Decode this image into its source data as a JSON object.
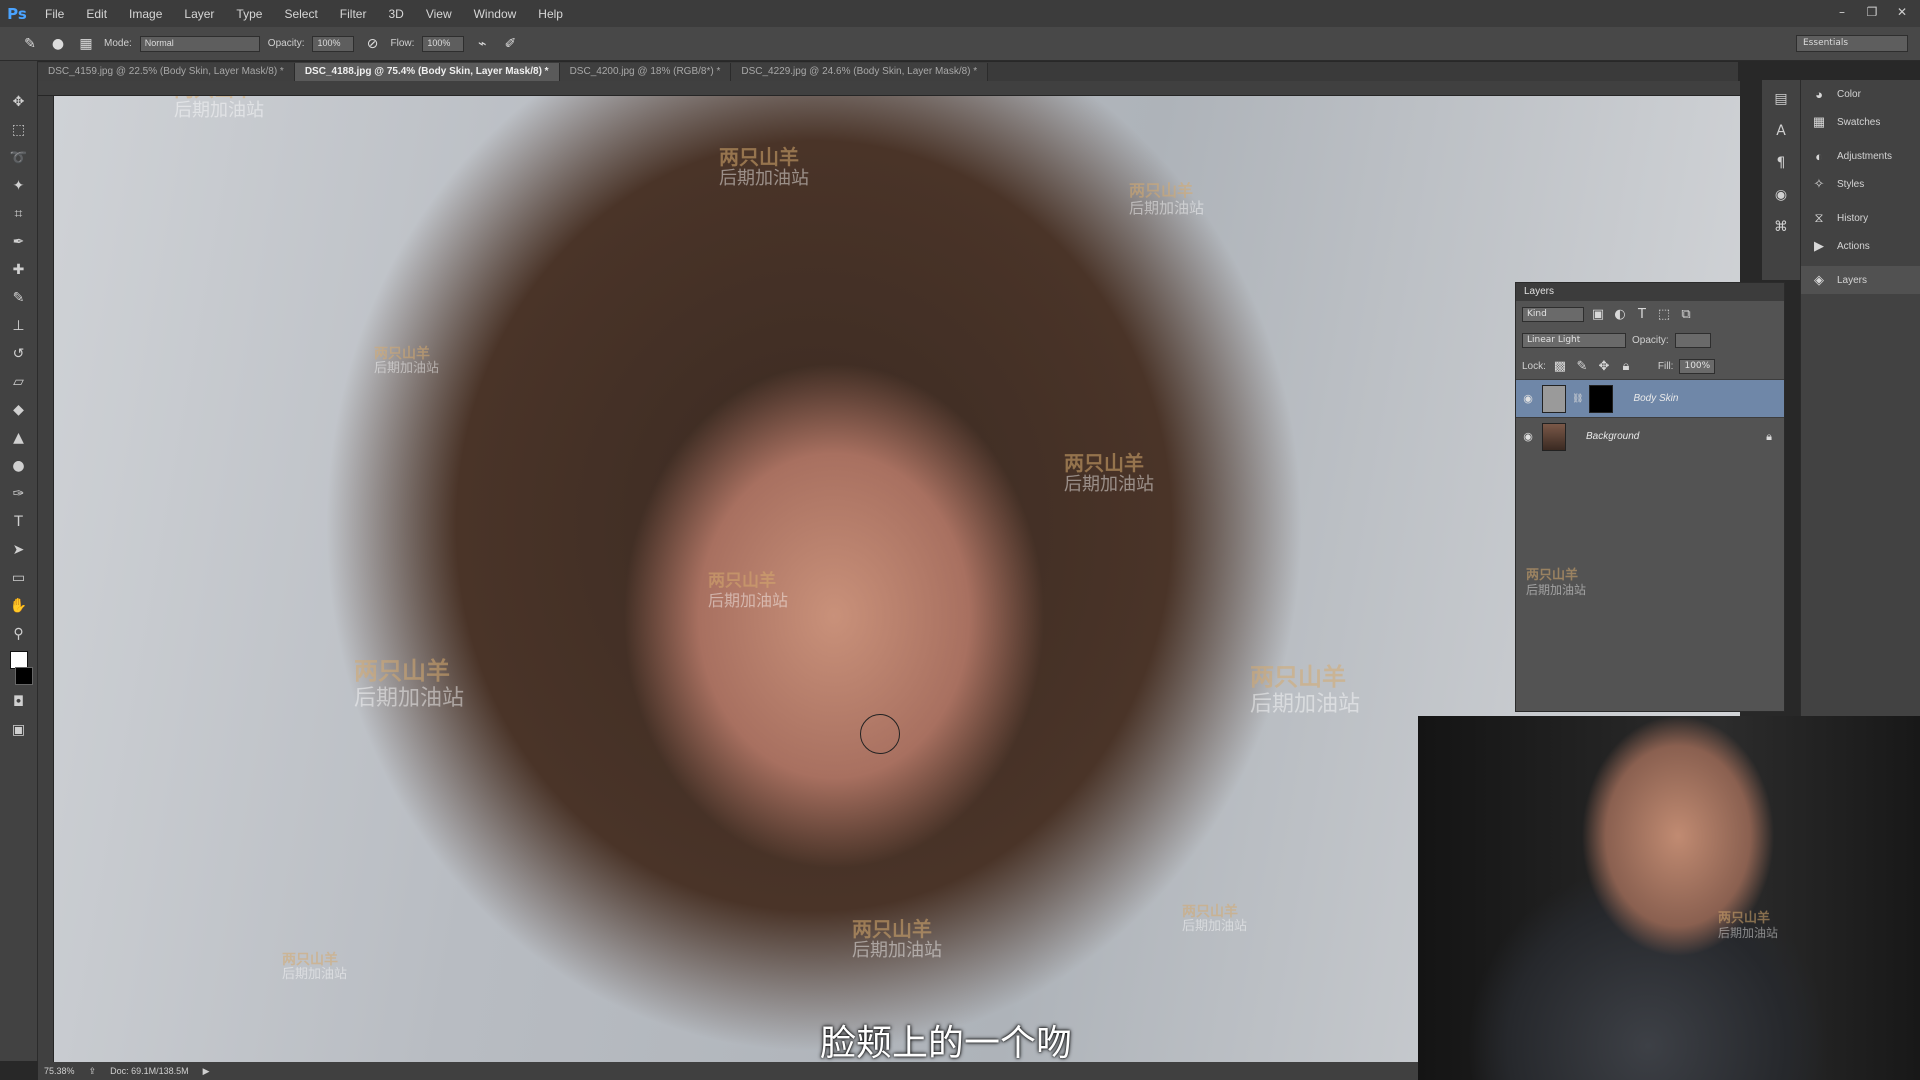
{
  "app": {
    "logo": "Ps",
    "menu": [
      "File",
      "Edit",
      "Image",
      "Layer",
      "Type",
      "Select",
      "Filter",
      "3D",
      "View",
      "Window",
      "Help"
    ],
    "window_controls": [
      "–",
      "❐",
      "✕"
    ]
  },
  "options_bar": {
    "mode_label": "Mode:",
    "mode_value": "Normal",
    "opacity_label": "Opacity:",
    "opacity_value": "100%",
    "flow_label": "Flow:",
    "flow_value": "100%",
    "workspace": "Essentials"
  },
  "tabs": [
    {
      "label": "DSC_4159.jpg @ 22.5% (Body Skin, Layer Mask/8) *",
      "active": false
    },
    {
      "label": "DSC_4188.jpg @ 75.4% (Body Skin, Layer Mask/8) *",
      "active": true
    },
    {
      "label": "DSC_4200.jpg @ 18% (RGB/8*) *",
      "active": false
    },
    {
      "label": "DSC_4229.jpg @ 24.6% (Body Skin, Layer Mask/8) *",
      "active": false
    }
  ],
  "watermark": {
    "line1": "两只山羊",
    "line2": "后期加油站"
  },
  "subtitle": "脸颊上的一个吻",
  "panel_strip": [
    "Color",
    "Swatches",
    "Adjustments",
    "Styles",
    "History",
    "Actions",
    "Layers"
  ],
  "layers_panel": {
    "title": "Layers",
    "filter_kind": "Kind",
    "blend_mode": "Linear Light",
    "opacity_label": "Opacity:",
    "opacity_value": "",
    "lock_label": "Lock:",
    "fill_label": "Fill:",
    "fill_value": "100%",
    "layers": [
      {
        "name": "Body Skin",
        "selected": true
      },
      {
        "name": "Background",
        "selected": false
      }
    ]
  },
  "status": {
    "zoom": "75.38%",
    "doc": "Doc: 69.1M/138.5M"
  },
  "colors": {
    "accent": "#4aa3ff",
    "selected_layer": "#6f87a8",
    "watermark": "#d6aa6e"
  }
}
